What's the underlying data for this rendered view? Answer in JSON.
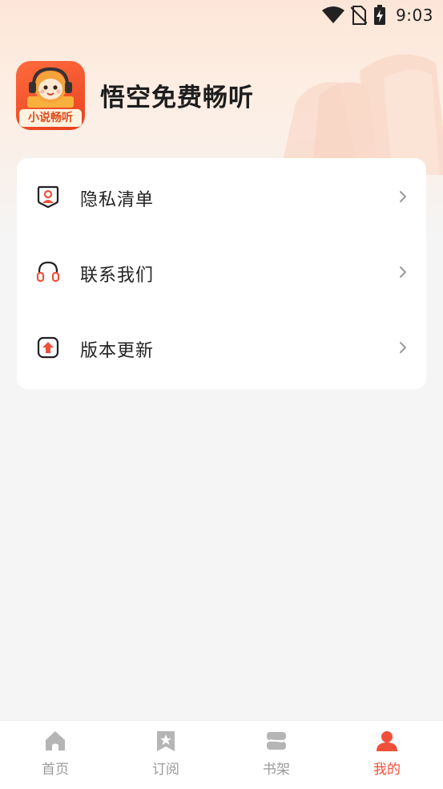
{
  "status_bar": {
    "time": "9:03",
    "icons": [
      "wifi-icon",
      "no-sim-icon",
      "battery-charging-icon"
    ]
  },
  "app": {
    "name": "悟空免费畅听",
    "logo_label": "小说畅听"
  },
  "menu": {
    "items": [
      {
        "label": "隐私清单",
        "icon": "privacy-list-icon"
      },
      {
        "label": "联系我们",
        "icon": "headset-icon"
      },
      {
        "label": "版本更新",
        "icon": "update-icon"
      }
    ]
  },
  "tabs": [
    {
      "label": "首页",
      "icon": "home-icon",
      "active": false
    },
    {
      "label": "订阅",
      "icon": "bookmark-star-icon",
      "active": false
    },
    {
      "label": "书架",
      "icon": "bookshelf-icon",
      "active": false
    },
    {
      "label": "我的",
      "icon": "profile-icon",
      "active": true
    }
  ],
  "colors": {
    "accent": "#f0503a",
    "tab_inactive": "#9a9a9a",
    "background": "#f5f5f5",
    "card": "#ffffff"
  }
}
